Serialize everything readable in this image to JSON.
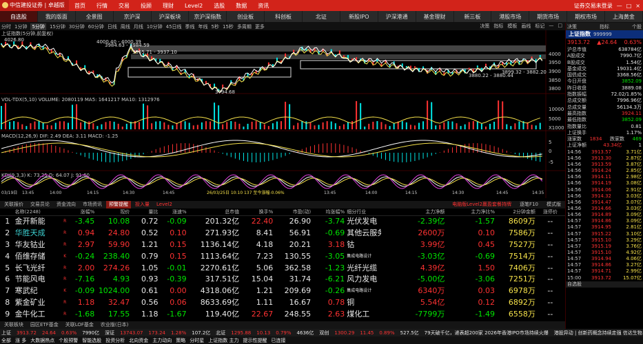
{
  "app": {
    "logo": "中信建投证券 | 卓越版",
    "menu": [
      "首页",
      "行情",
      "交易",
      "投顾",
      "理财",
      "Level2",
      "选股",
      "数据",
      "资讯"
    ],
    "right": [
      "证券交易未登录",
      "—",
      "□",
      "×"
    ]
  },
  "nav": [
    "自选股",
    "我的版面",
    "全景图",
    "京沪深",
    "沪深板块",
    "京沪深指数",
    "创业板",
    "科创板",
    "北证",
    "新股IPO",
    "沪深港通",
    "基金理财",
    "新三板",
    "港股市场",
    "期货市场",
    "期权市场",
    "上海黄金"
  ],
  "timeframes": [
    "分时",
    "1分钟",
    "5分钟",
    "15分钟",
    "30分钟",
    "60分钟",
    "日线",
    "周线",
    "月线",
    "10分钟",
    "45日线",
    "季线",
    "年线",
    "5秒",
    "15秒",
    "多周期",
    "更多"
  ],
  "tf_right": [
    "决策",
    "指标",
    "模板",
    "画线",
    "标记",
    "—",
    "□"
  ],
  "chart": {
    "title": "上证指数(5分钟,前复权)",
    "price_labels": [
      "4000.40 - 4000.39",
      "3984.63 - 3984.59",
      "3955.71 - 3937.10",
      "3899.32 - 3882.20",
      "3880.22 - 3880.44",
      "3794.68",
      "4026.80"
    ],
    "yaxis": [
      "4000",
      "3950",
      "3900",
      "3850",
      "3800"
    ],
    "vol_label": "VOL-TDX(5,10) VOLUME: 2080119  MA5: 1641217  MA10: 1312976",
    "vol_axis": [
      "10000",
      "5000",
      "X1000"
    ],
    "macd_label": "MACD(12,26,9) DIF: 2.49  DEA: 3.11  MACD: -1.25",
    "macd_axis": [
      "5",
      "0",
      "-5"
    ],
    "kdj_label": "KDJ(9,3,3) K: 73.25  D: 64.07  J: 91.60",
    "time_axis": [
      "03/19日",
      "13:45",
      "14:00",
      "14:15",
      "14:30",
      "14:45",
      "26/03/25日 10:10 137 至今涨幅-0.06%",
      "13:45",
      "14:00",
      "14:15",
      "14:30",
      "14:45",
      "14:35"
    ]
  },
  "right_panel": {
    "head": [
      "决策",
      "指标",
      "个股"
    ],
    "title": "上证指数",
    "code": "999999",
    "price": "3913.72",
    "change": "▲24.64",
    "pct": "0.63%",
    "kv": [
      {
        "k": "沪总市值",
        "v": "638784亿",
        "c": "white"
      },
      {
        "k": "A股成交",
        "v": "7990.7亿",
        "c": "white"
      },
      {
        "k": "B股成交",
        "v": "1.54亿",
        "c": "white"
      },
      {
        "k": "基金成交",
        "v": "19031.4亿",
        "c": "white"
      },
      {
        "k": "国债成交",
        "v": "3368.56亿",
        "c": "white"
      },
      {
        "k": "今日开盘",
        "v": "3852.09",
        "c": "green"
      },
      {
        "k": "昨日收盘",
        "v": "3889.08",
        "c": "white"
      },
      {
        "k": "指数振幅",
        "v": "72.02/1.85%",
        "c": "white"
      },
      {
        "k": "总成交额",
        "v": "7996.96亿",
        "c": "white"
      },
      {
        "k": "总成交量",
        "v": "56134.3万",
        "c": "white"
      },
      {
        "k": "最高指数",
        "v": "3924.11",
        "c": "red"
      },
      {
        "k": "最低指数",
        "v": "3852.09",
        "c": "green"
      },
      {
        "k": "指数量比",
        "v": "0.81",
        "c": "white"
      },
      {
        "k": "上证换手",
        "v": "1.17%",
        "c": "white"
      }
    ],
    "updown": {
      "label": "涨家数",
      "up": "1834",
      "flat_label": "跌家数",
      "down": "469"
    },
    "net": {
      "label": "上证净额",
      "v1": "43.34亿",
      "v2": "1"
    },
    "ticks": [
      [
        "14:56",
        "3913.57",
        "3.71亿"
      ],
      [
        "14:56",
        "3913.30",
        "2.87亿"
      ],
      [
        "14:56",
        "3913.59",
        "3.87亿"
      ],
      [
        "14:56",
        "3914.24",
        "2.85亿"
      ],
      [
        "14:56",
        "3914.11",
        "2.98亿"
      ],
      [
        "14:56",
        "3914.19",
        "3.08亿"
      ],
      [
        "14:56",
        "3914.06",
        "2.91亿"
      ],
      [
        "14:56",
        "3914.32",
        "3.03亿"
      ],
      [
        "14:56",
        "3914.47",
        "3.07亿"
      ],
      [
        "14:56",
        "3914.66",
        "3.03亿"
      ],
      [
        "14:56",
        "3914.89",
        "3.09亿"
      ],
      [
        "14:57",
        "3914.86",
        "3.09亿"
      ],
      [
        "14:57",
        "3914.95",
        "2.81亿"
      ],
      [
        "14:57",
        "3915.22",
        "3.10亿"
      ],
      [
        "14:57",
        "3915.10",
        "3.29亿"
      ],
      [
        "14:57",
        "3915.19",
        "3.76亿"
      ],
      [
        "14:57",
        "3915.10",
        "4.92亿"
      ],
      [
        "14:57",
        "3914.94",
        "4.06亿"
      ],
      [
        "14:57",
        "3914.86",
        "3.27亿"
      ],
      [
        "14:57",
        "3914.71",
        "2.99亿"
      ],
      [
        "15:00",
        "3913.72",
        "15.07亿"
      ]
    ],
    "bottom_label": "自选股"
  },
  "tabs": [
    "关联报价",
    "交易员论",
    "资金流向",
    "市场资讯",
    "预警提醒",
    "投入量",
    "Level2"
  ],
  "tabs_right": [
    "电脑版Level2赢盈套餐持牌",
    "逐笔F10",
    "模式版"
  ],
  "table": {
    "headers": [
      "",
      "名称(2248)",
      "",
      "涨幅%",
      "现价",
      "量比",
      "涨速%",
      "总市值",
      "换手%",
      "市盈(动)",
      "均涨幅%",
      "细分行业",
      "主力净额",
      "主力净比%",
      "2分钟金额",
      "涨停价"
    ],
    "rows": [
      {
        "i": "1",
        "name": "金开新能",
        "mark": "R",
        "pct": "-3.45",
        "price": "10.08",
        "vr": "0.72",
        "spd": "-0.09",
        "cap": "201.32亿",
        "turn": "22.40",
        "pe": "26.90",
        "avg": "-3.74",
        "ind": "光伏发电",
        "net": "-2.39亿",
        "ratio": "-1.57",
        "amt": "8609万",
        "lim": "--"
      },
      {
        "i": "2",
        "name": "华胜天成",
        "mark": "R",
        "pct": "0.94",
        "price": "24.80",
        "vr": "0.52",
        "spd": "0.10",
        "cap": "271.93亿",
        "turn": "8.41",
        "pe": "56.91",
        "avg": "-0.69",
        "ind": "其他云服务",
        "net": "2600万",
        "ratio": "0.10",
        "amt": "7586万",
        "lim": "--"
      },
      {
        "i": "3",
        "name": "华友钴业",
        "mark": "R",
        "pct": "2.97",
        "price": "59.90",
        "vr": "1.21",
        "spd": "0.15",
        "cap": "1136.14亿",
        "turn": "4.18",
        "pe": "20.21",
        "avg": "3.18",
        "ind": "钴",
        "net": "3.99亿",
        "ratio": "0.45",
        "amt": "7527万",
        "lim": "--"
      },
      {
        "i": "4",
        "name": "佰维存储",
        "mark": "K",
        "pct": "-0.24",
        "price": "238.40",
        "vr": "0.79",
        "spd": "0.15",
        "cap": "1113.64亿",
        "turn": "7.23",
        "pe": "130.55",
        "avg": "-3.05",
        "ind": "集成电路设计",
        "net": "-3.03亿",
        "ratio": "-0.69",
        "amt": "7514万",
        "lim": "--"
      },
      {
        "i": "5",
        "name": "长飞光纤",
        "mark": "R",
        "pct": "2.00",
        "price": "274.26",
        "vr": "1.05",
        "spd": "-0.01",
        "cap": "2270.61亿",
        "turn": "5.06",
        "pe": "362.58",
        "avg": "-1.23",
        "ind": "光纤光缆",
        "net": "4.39亿",
        "ratio": "1.50",
        "amt": "7406万",
        "lim": "--"
      },
      {
        "i": "6",
        "name": "节能风电",
        "mark": "R",
        "pct": "-7.16",
        "price": "4.93",
        "vr": "0.93",
        "spd": "-0.39",
        "cap": "317.51亿",
        "turn": "15.04",
        "pe": "31.74",
        "avg": "-6.21",
        "ind": "风力发电",
        "net": "-5.00亿",
        "ratio": "-3.06",
        "amt": "7251万",
        "lim": "--"
      },
      {
        "i": "7",
        "name": "寒武纪",
        "mark": "K",
        "pct": "-0.09",
        "price": "1024.00",
        "vr": "0.61",
        "spd": "0.00",
        "cap": "4318.06亿",
        "turn": "1.21",
        "pe": "209.69",
        "avg": "-0.26",
        "ind": "集成电路设计",
        "net": "6340万",
        "ratio": "0.03",
        "amt": "6978万",
        "lim": "--"
      },
      {
        "i": "8",
        "name": "紫金矿业",
        "mark": "R",
        "pct": "1.18",
        "price": "32.47",
        "vr": "0.56",
        "spd": "0.06",
        "cap": "8633.69亿",
        "turn": "1.11",
        "pe": "16.67",
        "avg": "0.78",
        "ind": "铜",
        "net": "5.54亿",
        "ratio": "0.12",
        "amt": "6892万",
        "lim": "--"
      },
      {
        "i": "9",
        "name": "金牛化工",
        "mark": "R",
        "pct": "-1.68",
        "price": "17.55",
        "vr": "1.18",
        "spd": "-1.67",
        "cap": "119.40亿",
        "turn": "22.67",
        "pe": "248.55",
        "avg": "2.63",
        "ind": "煤化工",
        "net": "-7799万",
        "ratio": "-1.49",
        "amt": "6558万",
        "lim": "--"
      }
    ]
  },
  "bottom_tabs": [
    "关联板块",
    "园区ETF基金",
    "关联LOF基金",
    "农业版(日本)"
  ],
  "status2": [
    "上证",
    "3913.72",
    "24.64",
    "0.63%",
    "7990亿",
    "深证",
    "13743.07",
    "173.24",
    "1.28%",
    "107.2亿",
    "北证",
    "1295.88",
    "10.13",
    "0.79%",
    "4636亿",
    "双创",
    "1300.29",
    "11.45",
    "0.89%",
    "527.5亿",
    "79天破千亿，递表超200家 2026年香港IPO市场持续火爆",
    "港股异动 | 创新药概念持续走强 信达生物..."
  ],
  "status": [
    "全部",
    "涨 多",
    "大数据热点",
    "个股预警",
    "智能选股",
    "投资分析",
    "北向资金",
    "主力动向",
    "策略",
    "分时星",
    "上证指数 主力",
    "提示性提醒",
    "已连接"
  ]
}
